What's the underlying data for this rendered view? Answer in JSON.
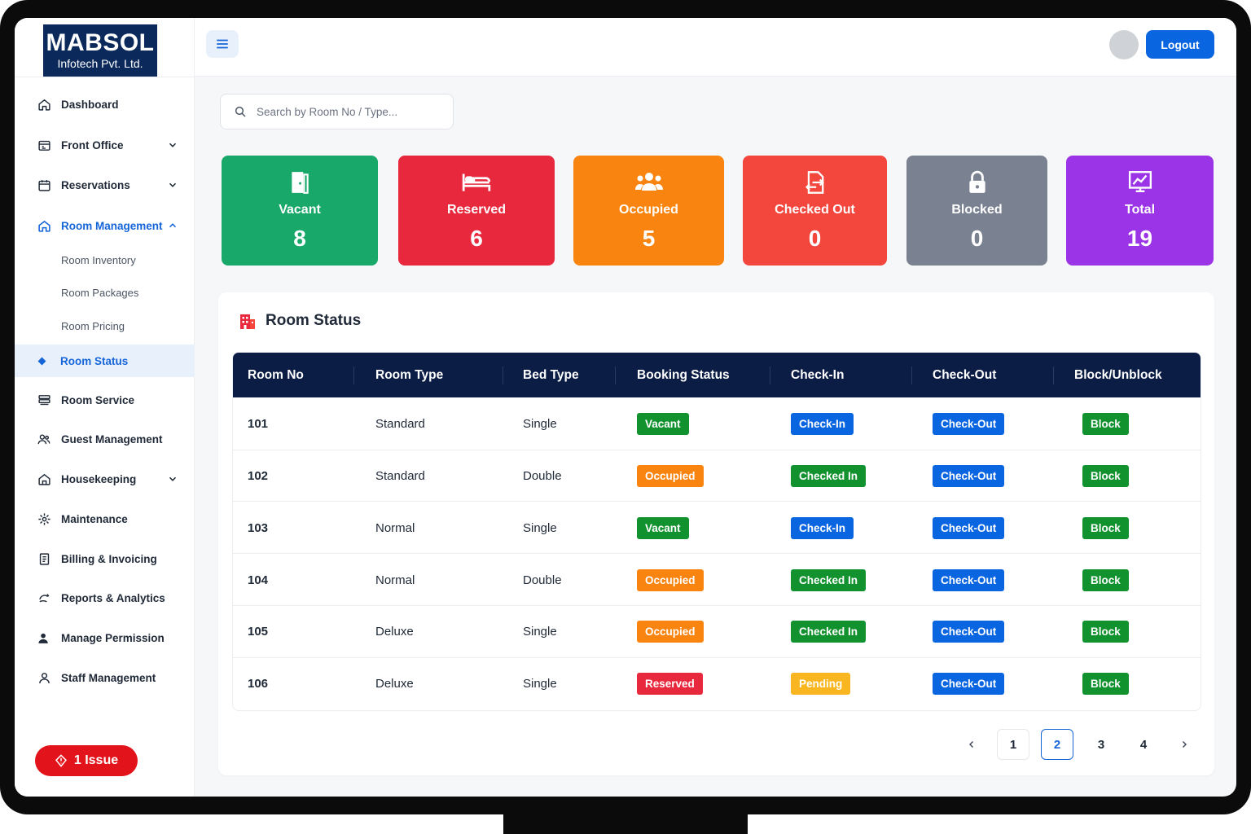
{
  "brand": {
    "name": "MABSOL",
    "sub": "Infotech Pvt. Ltd."
  },
  "header": {
    "logout": "Logout"
  },
  "search": {
    "placeholder": "Search by Room No / Type..."
  },
  "sidebar": {
    "items": [
      {
        "label": "Dashboard",
        "icon": "home-icon"
      },
      {
        "label": "Front Office",
        "icon": "front-office-icon",
        "expandable": true
      },
      {
        "label": "Reservations",
        "icon": "calendar-icon",
        "expandable": true
      },
      {
        "label": "Room Management",
        "icon": "building-icon",
        "expandable": true,
        "expanded": true
      },
      {
        "label": "Room Service",
        "icon": "room-service-icon"
      },
      {
        "label": "Guest Management",
        "icon": "users-icon"
      },
      {
        "label": "Housekeeping",
        "icon": "housekeeping-icon",
        "expandable": true
      },
      {
        "label": "Maintenance",
        "icon": "wrench-icon"
      },
      {
        "label": "Billing & Invoicing",
        "icon": "invoice-icon"
      },
      {
        "label": "Reports & Analytics",
        "icon": "chart-icon"
      },
      {
        "label": "Manage Permission",
        "icon": "user-lock-icon"
      },
      {
        "label": "Staff Management",
        "icon": "staff-icon"
      }
    ],
    "sub_items": [
      "Room Inventory",
      "Room Packages",
      "Room Pricing",
      "Room Status"
    ],
    "active_sub": "Room Status",
    "issue": "1 Issue"
  },
  "stats": [
    {
      "label": "Vacant",
      "value": "8",
      "icon": "door-icon",
      "color": "#17a86a"
    },
    {
      "label": "Reserved",
      "value": "6",
      "icon": "bed-icon",
      "color": "#e8283d"
    },
    {
      "label": "Occupied",
      "value": "5",
      "icon": "group-icon",
      "color": "#f98410"
    },
    {
      "label": "Checked Out",
      "value": "0",
      "icon": "checkout-icon",
      "color": "#f3463d"
    },
    {
      "label": "Blocked",
      "value": "0",
      "icon": "lock-icon",
      "color": "#7a8190"
    },
    {
      "label": "Total",
      "value": "19",
      "icon": "analytics-icon",
      "color": "#9a34e6"
    }
  ],
  "room_status": {
    "title": "Room Status",
    "columns": [
      "Room No",
      "Room Type",
      "Bed Type",
      "Booking Status",
      "Check-In",
      "Check-Out",
      "Block/Unblock"
    ],
    "rows": [
      {
        "room": "101",
        "type": "Standard",
        "bed": "Single",
        "status": "Vacant",
        "checkin": "Check-In",
        "checkout": "Check-Out",
        "block": "Block"
      },
      {
        "room": "102",
        "type": "Standard",
        "bed": "Double",
        "status": "Occupied",
        "checkin": "Checked In",
        "checkout": "Check-Out",
        "block": "Block"
      },
      {
        "room": "103",
        "type": "Normal",
        "bed": "Single",
        "status": "Vacant",
        "checkin": "Check-In",
        "checkout": "Check-Out",
        "block": "Block"
      },
      {
        "room": "104",
        "type": "Normal",
        "bed": "Double",
        "status": "Occupied",
        "checkin": "Checked In",
        "checkout": "Check-Out",
        "block": "Block"
      },
      {
        "room": "105",
        "type": "Deluxe",
        "bed": "Single",
        "status": "Occupied",
        "checkin": "Checked In",
        "checkout": "Check-Out",
        "block": "Block"
      },
      {
        "room": "106",
        "type": "Deluxe",
        "bed": "Single",
        "status": "Reserved",
        "checkin": "Pending",
        "checkout": "Check-Out",
        "block": "Block"
      }
    ]
  },
  "status_colors": {
    "Vacant": "#12922f",
    "Occupied": "#f98410",
    "Reserved": "#e8283d",
    "Check-In": "#0a66e0",
    "Checked In": "#12922f",
    "Pending": "#f9b621",
    "Check-Out": "#0a66e0",
    "Block": "#12922f"
  },
  "pagination": {
    "pages": [
      "1",
      "2",
      "3",
      "4"
    ],
    "current": "2"
  }
}
